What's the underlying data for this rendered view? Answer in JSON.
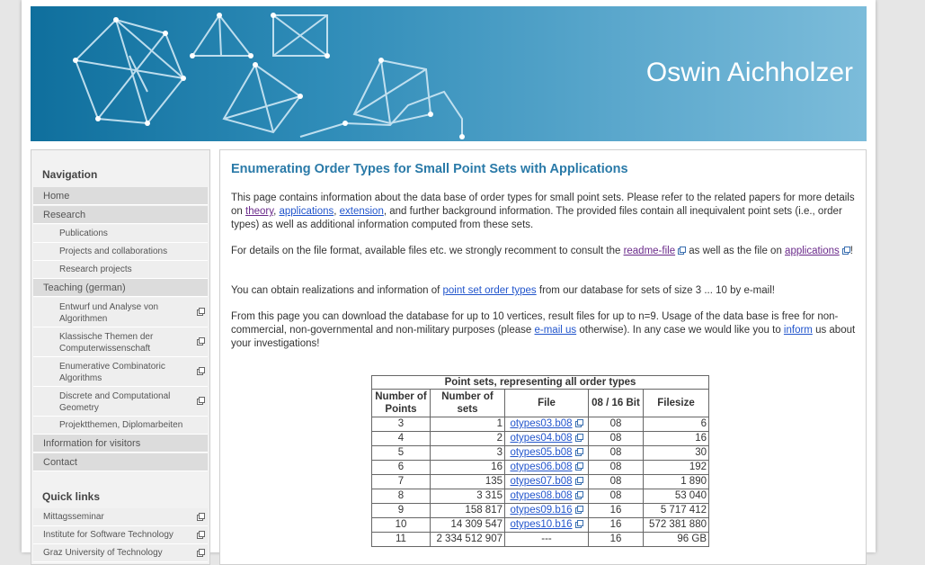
{
  "header": {
    "title": "Oswin Aichholzer"
  },
  "sidebar": {
    "navigation_heading": "Navigation",
    "items": [
      {
        "label": "Home"
      },
      {
        "label": "Research"
      },
      {
        "label": "Publications"
      },
      {
        "label": "Projects and collaborations"
      },
      {
        "label": "Research projects"
      },
      {
        "label": "Teaching (german)"
      },
      {
        "label": "Entwurf und Analyse von Algorithmen"
      },
      {
        "label": "Klassische Themen der Computerwissenschaft"
      },
      {
        "label": "Enumerative Combinatoric Algorithms"
      },
      {
        "label": "Discrete and Computational Geometry"
      },
      {
        "label": "Projektthemen, Diplomarbeiten"
      },
      {
        "label": "Information for visitors"
      },
      {
        "label": "Contact"
      }
    ],
    "quick_heading": "Quick links",
    "quick_links": [
      {
        "label": "Mittagsseminar"
      },
      {
        "label": "Institute for Software Technology"
      },
      {
        "label": "Graz University of Technology"
      }
    ]
  },
  "main": {
    "title": "Enumerating Order Types for Small Point Sets with Applications",
    "p1": {
      "a": "This page contains information about the data base of order types for small point sets. Please refer to the related papers for more details on ",
      "link_theory": "theory",
      "sep1": ", ",
      "link_applications": "applications",
      "sep2": ", ",
      "link_extension": "extension",
      "b": ", and further background information. The provided files contain all inequivalent point sets (i.e., order types) as well as additional information computed from these sets."
    },
    "p2": {
      "a": "For details on the file format, available files etc. we strongly recomment to consult the ",
      "link_readme": "readme-file",
      "b": " as well as the file on ",
      "link_applications": "applications",
      "c": "!"
    },
    "p3": {
      "a": "You can obtain realizations and information of ",
      "link_pst": "point set order types",
      "b": " from our database for sets of size 3 ... 10 by e-mail!"
    },
    "p4": {
      "a": "From this page you can download the database for up to 10 vertices, result files for up to n=9. Usage of the data base is free for non-commercial, non-governmental and non-military purposes (please ",
      "link_email": "e-mail us",
      "b": " otherwise). In any case we would like you to ",
      "link_inform": "inform",
      "c": " us about your investigations!"
    },
    "table": {
      "caption": "Point sets, representing all order types",
      "headers": [
        "Number of Points",
        "Number of sets",
        "File",
        "08 / 16 Bit",
        "Filesize"
      ],
      "rows": [
        {
          "points": "3",
          "sets": "1",
          "file": "otypes03.b08",
          "bits": "08",
          "size": "6"
        },
        {
          "points": "4",
          "sets": "2",
          "file": "otypes04.b08",
          "bits": "08",
          "size": "16"
        },
        {
          "points": "5",
          "sets": "3",
          "file": "otypes05.b08",
          "bits": "08",
          "size": "30"
        },
        {
          "points": "6",
          "sets": "16",
          "file": "otypes06.b08",
          "bits": "08",
          "size": "192"
        },
        {
          "points": "7",
          "sets": "135",
          "file": "otypes07.b08",
          "bits": "08",
          "size": "1 890"
        },
        {
          "points": "8",
          "sets": "3 315",
          "file": "otypes08.b08",
          "bits": "08",
          "size": "53 040"
        },
        {
          "points": "9",
          "sets": "158 817",
          "file": "otypes09.b16",
          "bits": "16",
          "size": "5 717 412"
        },
        {
          "points": "10",
          "sets": "14 309 547",
          "file": "otypes10.b16",
          "bits": "16",
          "size": "572 381 880"
        },
        {
          "points": "11",
          "sets": "2 334 512 907",
          "file": "---",
          "bits": "16",
          "size": "96 GB"
        }
      ]
    }
  },
  "colors": {
    "banner": "#2f8cb8",
    "title": "#2a7aa8",
    "link": "#2255cc",
    "visited_link": "#6a2a8a"
  },
  "icons": {
    "external_link": "external-link-icon"
  }
}
